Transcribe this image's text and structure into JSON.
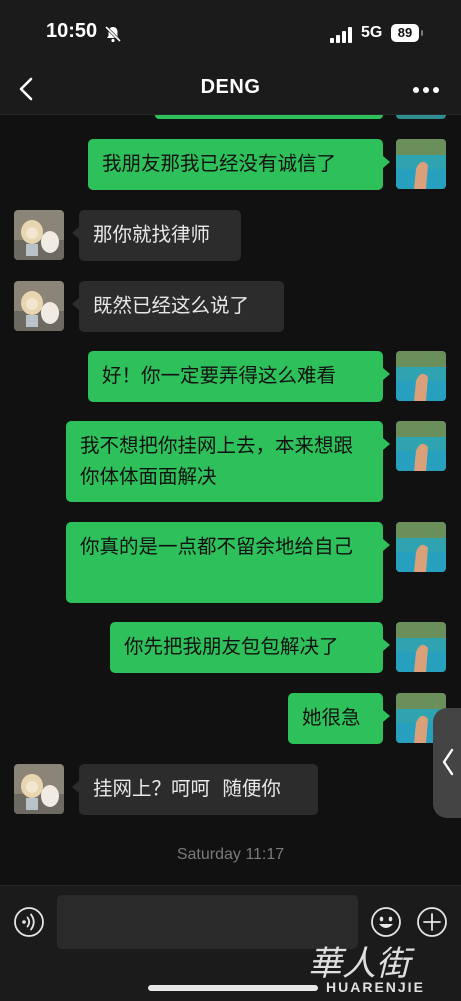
{
  "status_bar": {
    "time": "10:50",
    "network": "5G",
    "battery": "89"
  },
  "header": {
    "title": "DENG",
    "back_icon": "chevron-left-icon",
    "more_icon": "ellipsis-icon"
  },
  "messages": [
    {
      "from": "me",
      "text": "我朋友那我已经没有诚信了"
    },
    {
      "from": "them",
      "text": "那你就找律师"
    },
    {
      "from": "them",
      "text": "既然已经这么说了"
    },
    {
      "from": "me",
      "text": "好！你一定要弄得这么难看"
    },
    {
      "from": "me",
      "text": "我不想把你挂网上去，本来想跟你体体面面解决"
    },
    {
      "from": "me",
      "text": "你真的是一点都不留余地给自己"
    },
    {
      "from": "me",
      "text": "你先把我朋友包包解决了"
    },
    {
      "from": "me",
      "text": "她很急"
    },
    {
      "from": "them",
      "text": "挂网上？呵呵  随便你"
    }
  ],
  "timestamp": "Saturday 11:17",
  "input_bar": {
    "placeholder": "",
    "voice_icon": "voice-icon",
    "emoji_icon": "smiley-icon",
    "plus_icon": "plus-circle-icon"
  },
  "watermark": {
    "logo_text": "華人街",
    "sub_text": "HUARENJIE"
  },
  "colors": {
    "my_bubble": "#2ec05b",
    "their_bubble": "#2c2c2c",
    "background": "#111111",
    "bar": "#1b1b1b"
  }
}
